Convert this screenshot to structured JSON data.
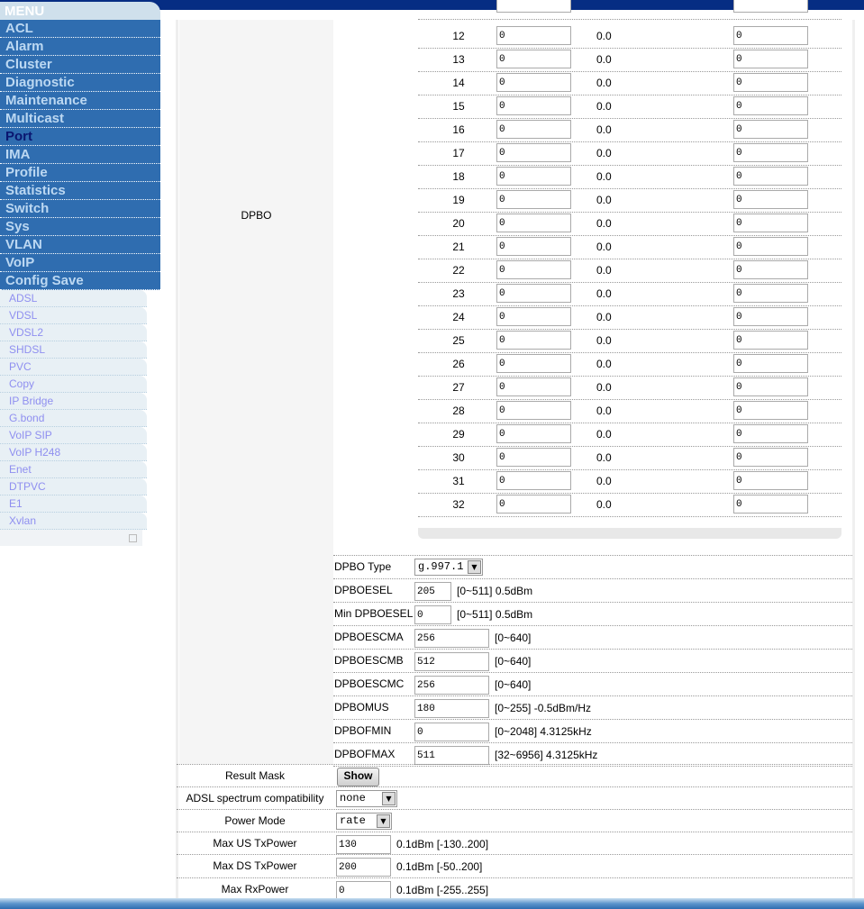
{
  "menu": {
    "title": "MENU",
    "items": [
      "ACL",
      "Alarm",
      "Cluster",
      "Diagnostic",
      "Maintenance",
      "Multicast",
      "Port",
      "IMA",
      "Profile",
      "Statistics",
      "Switch",
      "Sys",
      "VLAN",
      "VoIP",
      "Config Save"
    ],
    "active": "Port",
    "subitems": [
      "ADSL",
      "VDSL",
      "VDSL2",
      "SHDSL",
      "PVC",
      "Copy",
      "IP Bridge",
      "G.bond",
      "VoIP SIP",
      "VoIP H248",
      "Enet",
      "DTPVC",
      "E1",
      "Xvlan"
    ]
  },
  "dpbo": {
    "label": "DPBO",
    "rows": [
      {
        "n": "12",
        "a": "0",
        "v": "0.0",
        "b": "0"
      },
      {
        "n": "13",
        "a": "0",
        "v": "0.0",
        "b": "0"
      },
      {
        "n": "14",
        "a": "0",
        "v": "0.0",
        "b": "0"
      },
      {
        "n": "15",
        "a": "0",
        "v": "0.0",
        "b": "0"
      },
      {
        "n": "16",
        "a": "0",
        "v": "0.0",
        "b": "0"
      },
      {
        "n": "17",
        "a": "0",
        "v": "0.0",
        "b": "0"
      },
      {
        "n": "18",
        "a": "0",
        "v": "0.0",
        "b": "0"
      },
      {
        "n": "19",
        "a": "0",
        "v": "0.0",
        "b": "0"
      },
      {
        "n": "20",
        "a": "0",
        "v": "0.0",
        "b": "0"
      },
      {
        "n": "21",
        "a": "0",
        "v": "0.0",
        "b": "0"
      },
      {
        "n": "22",
        "a": "0",
        "v": "0.0",
        "b": "0"
      },
      {
        "n": "23",
        "a": "0",
        "v": "0.0",
        "b": "0"
      },
      {
        "n": "24",
        "a": "0",
        "v": "0.0",
        "b": "0"
      },
      {
        "n": "25",
        "a": "0",
        "v": "0.0",
        "b": "0"
      },
      {
        "n": "26",
        "a": "0",
        "v": "0.0",
        "b": "0"
      },
      {
        "n": "27",
        "a": "0",
        "v": "0.0",
        "b": "0"
      },
      {
        "n": "28",
        "a": "0",
        "v": "0.0",
        "b": "0"
      },
      {
        "n": "29",
        "a": "0",
        "v": "0.0",
        "b": "0"
      },
      {
        "n": "30",
        "a": "0",
        "v": "0.0",
        "b": "0"
      },
      {
        "n": "31",
        "a": "0",
        "v": "0.0",
        "b": "0"
      },
      {
        "n": "32",
        "a": "0",
        "v": "0.0",
        "b": "0"
      }
    ],
    "params": {
      "type": {
        "label": "DPBO Type",
        "value": "g.997.1"
      },
      "esel": {
        "label": "DPBOESEL",
        "value": "205",
        "range": "[0~511] 0.5dBm"
      },
      "minesel": {
        "label": "Min DPBOESEL",
        "value": "0",
        "range": "[0~511] 0.5dBm"
      },
      "escma": {
        "label": "DPBOESCMA",
        "value": "256",
        "range": "[0~640]"
      },
      "escmb": {
        "label": "DPBOESCMB",
        "value": "512",
        "range": "[0~640]"
      },
      "escmc": {
        "label": "DPBOESCMC",
        "value": "256",
        "range": "[0~640]"
      },
      "mus": {
        "label": "DPBOMUS",
        "value": "180",
        "range": "[0~255] -0.5dBm/Hz"
      },
      "fmin": {
        "label": "DPBOFMIN",
        "value": "0",
        "range": "[0~2048] 4.3125kHz"
      },
      "fmax": {
        "label": "DPBOFMAX",
        "value": "511",
        "range": "[32~6956] 4.3125kHz"
      }
    }
  },
  "lower": {
    "result_mask": {
      "label": "Result Mask",
      "button": "Show"
    },
    "adsl_compat": {
      "label": "ADSL spectrum compatibility",
      "value": "none"
    },
    "power_mode": {
      "label": "Power Mode",
      "value": "rate"
    },
    "max_us": {
      "label": "Max US TxPower",
      "value": "130",
      "range": "0.1dBm [-130..200]"
    },
    "max_ds": {
      "label": "Max DS TxPower",
      "value": "200",
      "range": "0.1dBm [-50..200]"
    },
    "max_rx": {
      "label": "Max RxPower",
      "value": "0",
      "range": "0.1dBm [-255..255]"
    }
  },
  "colors": {
    "topbar": "#062d83",
    "menu_bg": "#2f6db0",
    "menu_text": "#bcd8f2",
    "menu_active": "#0a1670",
    "submenu_text": "#8f8ff0"
  }
}
